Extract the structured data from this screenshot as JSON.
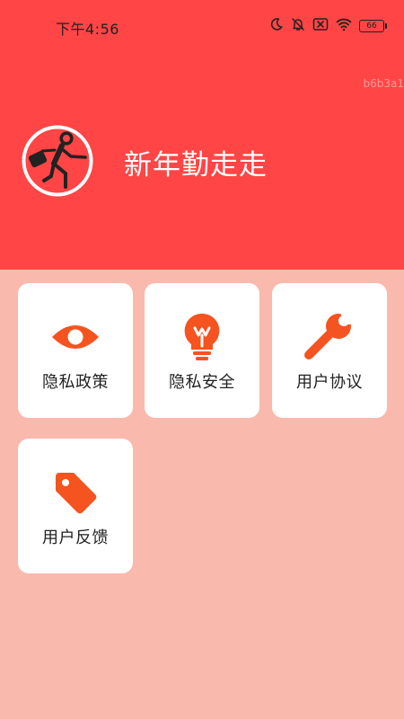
{
  "status_bar": {
    "time": "下午4:56",
    "battery": "66",
    "icons": [
      "moon-icon",
      "bell-off-icon",
      "no-sim-icon",
      "wifi-icon",
      "battery-icon"
    ]
  },
  "header": {
    "watermark": "b6b3a1",
    "app_title": "新年勤走走",
    "logo": "running-man-logo"
  },
  "theme": {
    "header_bg": "#ff4545",
    "page_bg": "#fab9ad",
    "icon_color": "#f5531f"
  },
  "menu": {
    "items": [
      {
        "label": "隐私政策",
        "icon": "eye-icon"
      },
      {
        "label": "隐私安全",
        "icon": "lightbulb-icon"
      },
      {
        "label": "用户协议",
        "icon": "wrench-icon"
      },
      {
        "label": "用户反馈",
        "icon": "tag-icon"
      }
    ]
  }
}
